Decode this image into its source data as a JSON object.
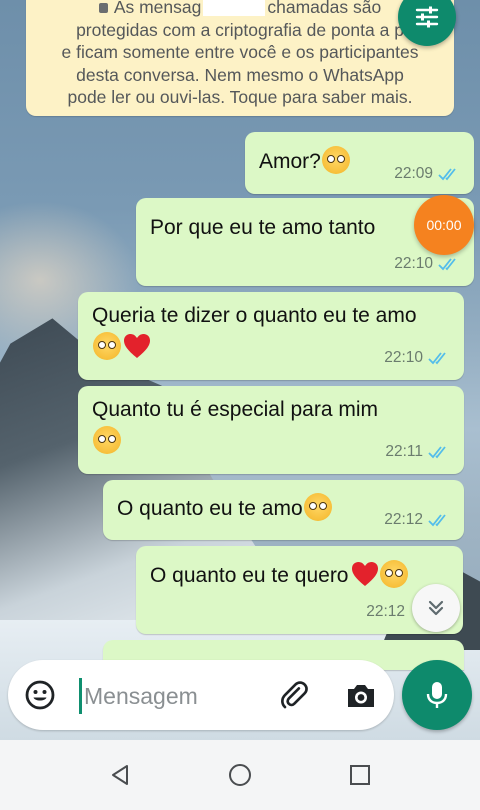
{
  "notice": {
    "lines": [
      "As mensag",
      "chamadas são",
      "protegidas com a criptografia de ponta a p",
      "e ficam somente entre você e os participantes",
      "desta conversa. Nem mesmo o WhatsApp",
      "pode ler ou ouvi-las. Toque para saber mais."
    ]
  },
  "messages": [
    {
      "text": "Amor?",
      "emoji": "pleading-face",
      "time": "22:09",
      "status": "read"
    },
    {
      "text": "Por que eu te amo tanto",
      "time": "22:10",
      "status": "read"
    },
    {
      "text": "Queria te dizer o quanto eu te amo",
      "emoji": "pleading-face",
      "emoji2": "red-heart",
      "time": "22:10",
      "status": "read"
    },
    {
      "text": "Quanto tu é especial para mim",
      "emoji": "pleading-face",
      "time": "22:11",
      "status": "read"
    },
    {
      "text": "O quanto eu te amo",
      "emoji": "pleading-face",
      "time": "22:12",
      "status": "read"
    },
    {
      "text": "O quanto eu te quero",
      "emoji": "red-heart",
      "emoji2": "pleading-face",
      "time": "22:12",
      "status": "read"
    }
  ],
  "timer_badge": "00:00",
  "composer": {
    "placeholder": "Mensagem"
  },
  "icons": {
    "filter": "sliders-icon",
    "emoji": "emoji-icon",
    "attach": "paperclip-icon",
    "camera": "camera-icon",
    "mic": "mic-icon",
    "scroll": "double-chevron-down-icon",
    "nav_back": "triangle-back-icon",
    "nav_home": "circle-home-icon",
    "nav_recent": "square-recents-icon"
  },
  "colors": {
    "outgoing_bubble": "#dcf8c6",
    "notice_bg": "#fdf2c6",
    "accent_green": "#0e8a6c",
    "read_tick": "#53bdeb",
    "timer_orange": "#f5821f"
  }
}
